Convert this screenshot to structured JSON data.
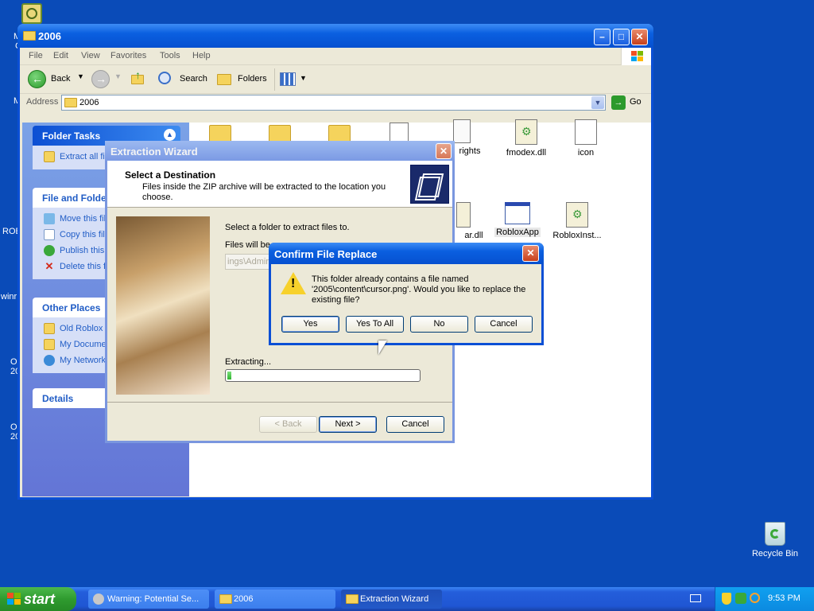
{
  "desktop": {
    "partial_labels": [
      "M",
      "C",
      "M",
      "ROB",
      "winr",
      "Ol",
      "20",
      "Ol",
      "20"
    ],
    "recycle_bin_label": "Recycle Bin"
  },
  "explorer": {
    "title": "2006",
    "menu": [
      "File",
      "Edit",
      "View",
      "Favorites",
      "Tools",
      "Help"
    ],
    "toolbar": {
      "back": "Back",
      "search": "Search",
      "folders": "Folders"
    },
    "address_label": "Address",
    "address_value": "2006",
    "go_label": "Go",
    "folder_tasks": {
      "title": "Folder Tasks",
      "items": [
        "Extract all fi"
      ]
    },
    "file_tasks": {
      "title": "File and Folder",
      "items": [
        "Move this fil",
        "Copy this fil",
        "Publish this",
        "Delete this f"
      ]
    },
    "other_places": {
      "title": "Other Places",
      "items": [
        "Old Roblox 2",
        "My Documen",
        "My Network"
      ]
    },
    "details_title": "Details",
    "files": [
      "rights",
      "fmodex.dll",
      "icon",
      "ar.dll",
      "RobloxApp",
      "RobloxInst..."
    ]
  },
  "wizard": {
    "title": "Extraction Wizard",
    "heading": "Select a Destination",
    "subheading": "Files inside the ZIP archive will be extracted to the location you choose.",
    "select_label": "Select a folder to extract files to.",
    "files_will_be": "Files will be",
    "path_value": "ings\\Admin",
    "extracting_label": "Extracting...",
    "progress": 0.02,
    "back_label": "< Back",
    "next_label": "Next >",
    "cancel_label": "Cancel"
  },
  "confirm": {
    "title": "Confirm File Replace",
    "message_line1": "This folder already contains a file named",
    "message_line2": "'2005\\content\\cursor.png'.  Would you like to replace the",
    "message_line3": "existing file?",
    "yes": "Yes",
    "yes_to_all": "Yes To All",
    "no": "No",
    "cancel": "Cancel"
  },
  "taskbar": {
    "start_label": "start",
    "tasks": [
      "Warning: Potential Se...",
      "2006",
      "Extraction Wizard"
    ],
    "clock": "9:53 PM"
  },
  "colors": {
    "desktop": "#0a4bb8",
    "xp_blue": "#0650d0",
    "start_green": "#2f9b2f"
  }
}
